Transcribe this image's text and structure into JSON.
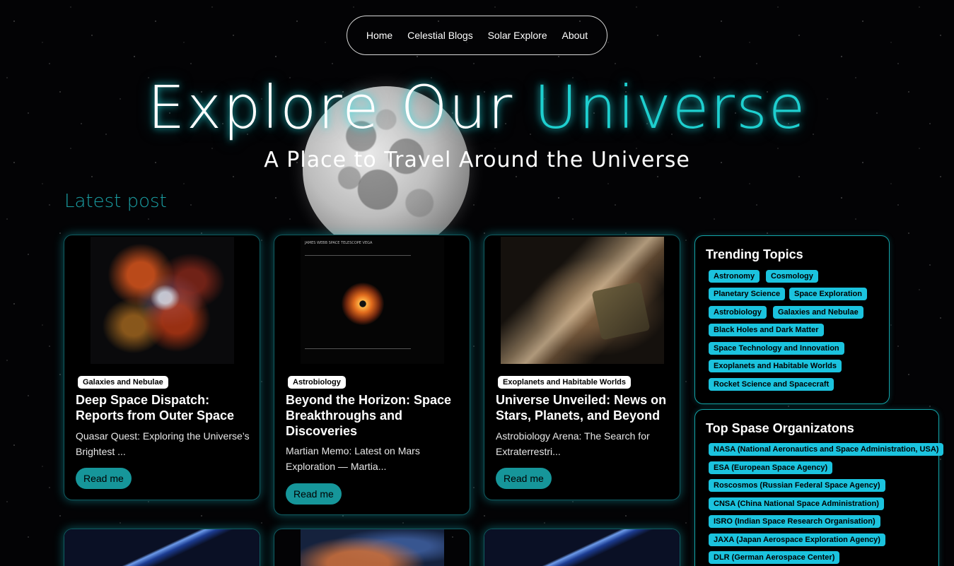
{
  "nav": {
    "items": [
      {
        "label": "Home"
      },
      {
        "label": "Celestial Blogs"
      },
      {
        "label": "Solar Explore"
      },
      {
        "label": "About"
      }
    ]
  },
  "hero": {
    "title_main": "Explore Our ",
    "title_accent": "Universe",
    "subtitle": "A Place to Travel Around the Universe"
  },
  "latest": {
    "heading": "Latest post",
    "cards": [
      {
        "tag": "Galaxies and Nebulae",
        "title": "Deep Space Dispatch: Reports from Outer Space",
        "excerpt": "Quasar Quest: Exploring the Universe’s Brightest ...",
        "button": "Read me",
        "image": "nebula-image"
      },
      {
        "tag": "Astrobiology",
        "title": "Beyond the Horizon: Space Breakthroughs and Discoveries",
        "excerpt": "Martian Memo: Latest on Mars Exploration — Martia...",
        "button": "Read me",
        "image": "vega-telescope-image",
        "image_text": "JAMES WEBB SPACE TELESCOPE VEGA"
      },
      {
        "tag": "Exoplanets and Habitable Worlds",
        "title": "Universe Unveiled: News on Stars, Planets, and Beyond",
        "excerpt": "Astrobiology Arena: The Search for Extraterrestri...",
        "button": "Read me",
        "image": "milky-way-probe-image"
      }
    ]
  },
  "trending": {
    "heading": "Trending Topics",
    "topics": [
      "Astronomy",
      "Cosmology",
      "Planetary Science",
      "Space Exploration",
      "Astrobiology",
      "Galaxies and Nebulae",
      "Black Holes and Dark Matter",
      "Space Technology and Innovation",
      "Exoplanets and Habitable Worlds",
      "Rocket Science and Spacecraft"
    ]
  },
  "organizations": {
    "heading": "Top Spase Organizatons",
    "items": [
      "NASA (National Aeronautics and Space Administration, USA)",
      "ESA (European Space Agency)",
      "Roscosmos (Russian Federal Space Agency)",
      "CNSA (China National Space Administration)",
      "ISRO (Indian Space Research Organisation)",
      "JAXA (Japan Aerospace Exploration Agency)",
      "DLR (German Aerospace Center)"
    ]
  },
  "colors": {
    "accent": "#1ecfcf",
    "button": "#16969a",
    "chip": "#1bc3de"
  }
}
